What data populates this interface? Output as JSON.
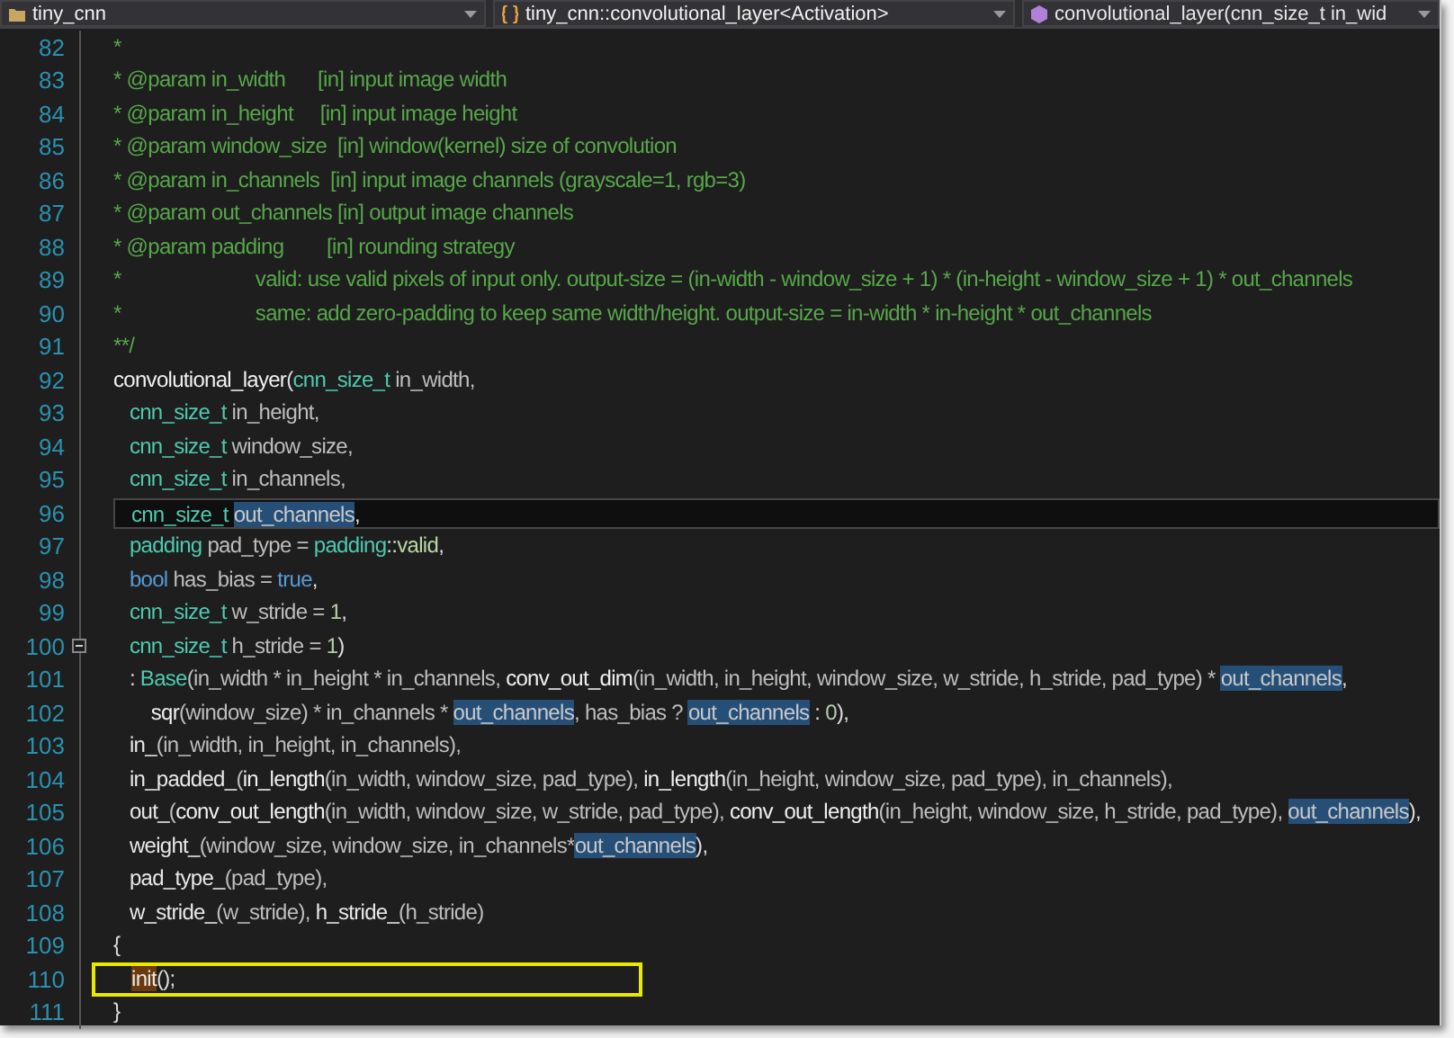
{
  "navigation": [
    {
      "kind": "project",
      "text": "tiny_cnn"
    },
    {
      "kind": "class",
      "text": "tiny_cnn::convolutional_layer<Activation>"
    },
    {
      "kind": "member",
      "text": "convolutional_layer(cnn_size_t in_wid"
    }
  ],
  "lines": [
    {
      "number": "82",
      "kind": "normal",
      "fold": false,
      "tokens": [
        {
          "kind": "comment",
          "text": "*"
        }
      ]
    },
    {
      "number": "83",
      "kind": "normal",
      "fold": false,
      "tokens": [
        {
          "kind": "comment",
          "text": "* @param in_width      [in] input image width"
        }
      ]
    },
    {
      "number": "84",
      "kind": "normal",
      "fold": false,
      "tokens": [
        {
          "kind": "comment",
          "text": "* @param in_height     [in] input image height"
        }
      ]
    },
    {
      "number": "85",
      "kind": "normal",
      "fold": false,
      "tokens": [
        {
          "kind": "comment",
          "text": "* @param window_size  [in] window(kernel) size of convolution"
        }
      ]
    },
    {
      "number": "86",
      "kind": "normal",
      "fold": false,
      "tokens": [
        {
          "kind": "comment",
          "text": "* @param in_channels  [in] input image channels (grayscale=1, rgb=3)"
        }
      ]
    },
    {
      "number": "87",
      "kind": "normal",
      "fold": false,
      "tokens": [
        {
          "kind": "comment",
          "text": "* @param out_channels [in] output image channels"
        }
      ]
    },
    {
      "number": "88",
      "kind": "normal",
      "fold": false,
      "tokens": [
        {
          "kind": "comment",
          "text": "* @param padding        [in] rounding strategy"
        }
      ]
    },
    {
      "number": "89",
      "kind": "normal",
      "fold": false,
      "tokens": [
        {
          "kind": "comment",
          "text": "*                         valid: use valid pixels of input only. output-size = (in-width - window_size + 1) * (in-height - window_size + 1) * out_channels"
        }
      ]
    },
    {
      "number": "90",
      "kind": "normal",
      "fold": false,
      "tokens": [
        {
          "kind": "comment",
          "text": "*                         same: add zero-padding to keep same width/height. output-size = in-width * in-height * out_channels"
        }
      ]
    },
    {
      "number": "91",
      "kind": "normal",
      "fold": false,
      "tokens": [
        {
          "kind": "comment",
          "text": "**/"
        }
      ]
    },
    {
      "number": "92",
      "kind": "normal",
      "fold": false,
      "tokens": [
        {
          "kind": "func",
          "text": "convolutional_layer"
        },
        {
          "kind": "plain",
          "text": "("
        },
        {
          "kind": "type",
          "text": "cnn_size_t"
        },
        {
          "kind": "param",
          "text": " in_width,"
        }
      ]
    },
    {
      "number": "93",
      "kind": "normal",
      "fold": false,
      "tokens": [
        {
          "kind": "type",
          "text": "   cnn_size_t"
        },
        {
          "kind": "param",
          "text": " in_height,"
        }
      ]
    },
    {
      "number": "94",
      "kind": "normal",
      "fold": false,
      "tokens": [
        {
          "kind": "type",
          "text": "   cnn_size_t"
        },
        {
          "kind": "param",
          "text": " window_size,"
        }
      ]
    },
    {
      "number": "95",
      "kind": "normal",
      "fold": false,
      "tokens": [
        {
          "kind": "type",
          "text": "   cnn_size_t"
        },
        {
          "kind": "param",
          "text": " in_channels,"
        }
      ]
    },
    {
      "number": "96",
      "kind": "current",
      "fold": false,
      "tokens": [
        {
          "kind": "type",
          "text": "   cnn_size_t "
        },
        {
          "kind": "ref",
          "text": "out_channels"
        },
        {
          "kind": "plain",
          "text": ","
        }
      ]
    },
    {
      "number": "97",
      "kind": "normal",
      "fold": false,
      "tokens": [
        {
          "kind": "type",
          "text": "   padding"
        },
        {
          "kind": "param",
          "text": " pad_type = "
        },
        {
          "kind": "type",
          "text": "padding"
        },
        {
          "kind": "plain",
          "text": "::"
        },
        {
          "kind": "enum",
          "text": "valid"
        },
        {
          "kind": "plain",
          "text": ","
        }
      ]
    },
    {
      "number": "98",
      "kind": "normal",
      "fold": false,
      "tokens": [
        {
          "kind": "keyword",
          "text": "   bool"
        },
        {
          "kind": "param",
          "text": " has_bias = "
        },
        {
          "kind": "keyword",
          "text": "true"
        },
        {
          "kind": "plain",
          "text": ","
        }
      ]
    },
    {
      "number": "99",
      "kind": "normal",
      "fold": false,
      "tokens": [
        {
          "kind": "type",
          "text": "   cnn_size_t"
        },
        {
          "kind": "param",
          "text": " w_stride = "
        },
        {
          "kind": "number",
          "text": "1"
        },
        {
          "kind": "plain",
          "text": ","
        }
      ]
    },
    {
      "number": "100",
      "kind": "normal",
      "fold": true,
      "tokens": [
        {
          "kind": "type",
          "text": "   cnn_size_t"
        },
        {
          "kind": "param",
          "text": " h_stride = "
        },
        {
          "kind": "number",
          "text": "1"
        },
        {
          "kind": "plain",
          "text": ")"
        }
      ]
    },
    {
      "number": "101",
      "kind": "normal",
      "fold": false,
      "tokens": [
        {
          "kind": "plain",
          "text": "   : "
        },
        {
          "kind": "type",
          "text": "Base"
        },
        {
          "kind": "param",
          "text": "(in_width * in_height * in_channels, "
        },
        {
          "kind": "func",
          "text": "conv_out_dim"
        },
        {
          "kind": "param",
          "text": "(in_width, in_height, window_size, w_stride, h_stride, pad_type) * "
        },
        {
          "kind": "ref",
          "text": "out_channels"
        },
        {
          "kind": "plain",
          "text": ","
        }
      ]
    },
    {
      "number": "102",
      "kind": "normal",
      "fold": false,
      "tokens": [
        {
          "kind": "func",
          "text": "       sqr"
        },
        {
          "kind": "param",
          "text": "(window_size) * in_channels * "
        },
        {
          "kind": "ref",
          "text": "out_channels"
        },
        {
          "kind": "param",
          "text": ", has_bias ? "
        },
        {
          "kind": "ref",
          "text": "out_channels"
        },
        {
          "kind": "plain",
          "text": " : "
        },
        {
          "kind": "number",
          "text": "0"
        },
        {
          "kind": "plain",
          "text": "),"
        }
      ]
    },
    {
      "number": "103",
      "kind": "normal",
      "fold": false,
      "tokens": [
        {
          "kind": "member",
          "text": "   in_"
        },
        {
          "kind": "param",
          "text": "(in_width, in_height, in_channels),"
        }
      ]
    },
    {
      "number": "104",
      "kind": "normal",
      "fold": false,
      "tokens": [
        {
          "kind": "member",
          "text": "   in_padded_"
        },
        {
          "kind": "param",
          "text": "("
        },
        {
          "kind": "func",
          "text": "in_length"
        },
        {
          "kind": "param",
          "text": "(in_width, window_size, pad_type), "
        },
        {
          "kind": "func",
          "text": "in_length"
        },
        {
          "kind": "param",
          "text": "(in_height, window_size, pad_type), in_channels),"
        }
      ]
    },
    {
      "number": "105",
      "kind": "normal",
      "fold": false,
      "tokens": [
        {
          "kind": "member",
          "text": "   out_"
        },
        {
          "kind": "param",
          "text": "("
        },
        {
          "kind": "func",
          "text": "conv_out_length"
        },
        {
          "kind": "param",
          "text": "(in_width, window_size, w_stride, pad_type), "
        },
        {
          "kind": "func",
          "text": "conv_out_length"
        },
        {
          "kind": "param",
          "text": "(in_height, window_size, h_stride, pad_type), "
        },
        {
          "kind": "ref",
          "text": "out_channels"
        },
        {
          "kind": "plain",
          "text": "),"
        }
      ]
    },
    {
      "number": "106",
      "kind": "normal",
      "fold": false,
      "tokens": [
        {
          "kind": "member",
          "text": "   weight_"
        },
        {
          "kind": "param",
          "text": "(window_size, window_size, in_channels*"
        },
        {
          "kind": "ref",
          "text": "out_channels"
        },
        {
          "kind": "plain",
          "text": "),"
        }
      ]
    },
    {
      "number": "107",
      "kind": "normal",
      "fold": false,
      "tokens": [
        {
          "kind": "member",
          "text": "   pad_type_"
        },
        {
          "kind": "param",
          "text": "(pad_type),"
        }
      ]
    },
    {
      "number": "108",
      "kind": "normal",
      "fold": false,
      "tokens": [
        {
          "kind": "member",
          "text": "   w_stride_"
        },
        {
          "kind": "param",
          "text": "(w_stride), "
        },
        {
          "kind": "member",
          "text": "h_stride_"
        },
        {
          "kind": "param",
          "text": "(h_stride)"
        }
      ]
    },
    {
      "number": "109",
      "kind": "normal",
      "fold": false,
      "tokens": [
        {
          "kind": "plain",
          "text": "{"
        }
      ]
    },
    {
      "number": "110",
      "kind": "boxed",
      "fold": false,
      "tokens": [
        {
          "kind": "match",
          "text": "init"
        },
        {
          "kind": "plain",
          "text": "();"
        }
      ]
    },
    {
      "number": "111",
      "kind": "normal",
      "fold": false,
      "tokens": [
        {
          "kind": "plain",
          "text": "}"
        }
      ]
    }
  ]
}
